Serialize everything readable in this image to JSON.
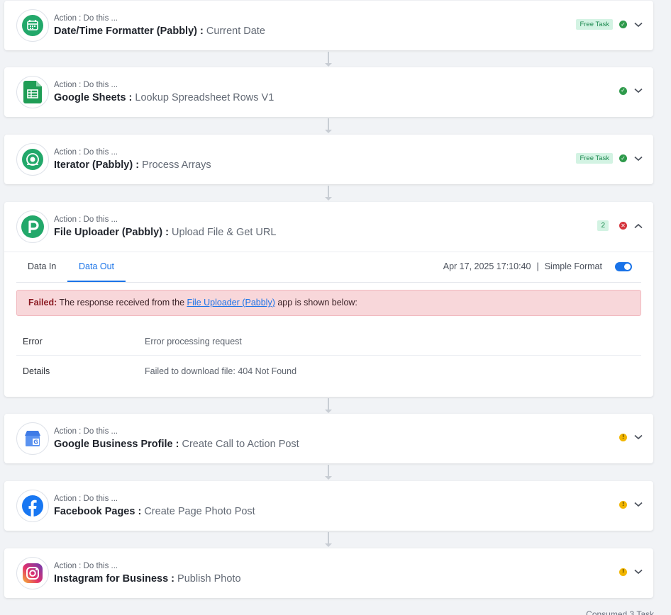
{
  "steps": [
    {
      "pre": "Action : Do this ...",
      "app": "Date/Time Formatter (Pabbly) :",
      "event": " Current Date",
      "badge": "Free Task",
      "icon": "calendar-icon",
      "status": "success"
    },
    {
      "pre": "Action : Do this ...",
      "app": "Google Sheets :",
      "event": " Lookup Spreadsheet Rows V1",
      "badge": "",
      "icon": "google-sheets-icon",
      "status": "success"
    },
    {
      "pre": "Action : Do this ...",
      "app": "Iterator (Pabbly) :",
      "event": " Process Arrays",
      "badge": "Free Task",
      "icon": "iterator-icon",
      "status": "success"
    },
    {
      "pre": "Action : Do this ...",
      "app": "File Uploader (Pabbly) :",
      "event": " Upload File & Get URL",
      "count": "2",
      "icon": "pabbly-p-icon",
      "status": "failed"
    },
    {
      "pre": "Action : Do this ...",
      "app": "Google Business Profile :",
      "event": " Create Call to Action Post",
      "icon": "google-business-icon",
      "status": "warning"
    },
    {
      "pre": "Action : Do this ...",
      "app": "Facebook Pages :",
      "event": " Create Page Photo Post",
      "icon": "facebook-icon",
      "status": "warning"
    },
    {
      "pre": "Action : Do this ...",
      "app": "Instagram for Business :",
      "event": " Publish Photo",
      "icon": "instagram-icon",
      "status": "warning"
    }
  ],
  "detail": {
    "tabs": [
      "Data In",
      "Data Out"
    ],
    "active_tab": "Data Out",
    "timestamp": "Apr 17, 2025 17:10:40",
    "separator": "|",
    "format_label": "Simple Format",
    "alert_strong": "Failed:",
    "alert_text_1": " The response received from the ",
    "alert_link": "File Uploader (Pabbly)",
    "alert_text_2": " app is shown below:",
    "rows": [
      {
        "key": "Error",
        "value": "Error processing request"
      },
      {
        "key": "Details",
        "value": "Failed to download file: 404 Not Found"
      }
    ]
  },
  "footer": {
    "consumed": "Consumed 3 Task"
  },
  "colors": {
    "accent": "#1a73e8",
    "success": "#2e9a4b",
    "error": "#d5353d",
    "warning": "#f2b600"
  }
}
